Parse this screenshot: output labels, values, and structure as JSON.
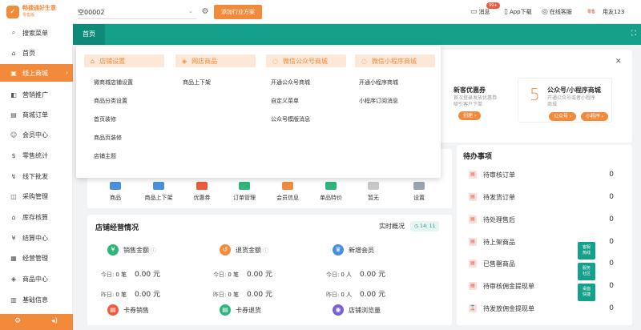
{
  "app": {
    "logo_line1": "畅捷通好生意",
    "logo_line2": "零售版",
    "store_select_value": "空00002",
    "add_plan_label": "添加行业方案",
    "msg_label": "消息",
    "msg_badge": "99+",
    "app_download_label": "App下载",
    "service_label": "在线客服",
    "avatar_text": "零售",
    "user_name": "用友123"
  },
  "sidebar": {
    "items": [
      {
        "label": "搜索菜单",
        "icon": "search-icon"
      },
      {
        "label": "首页",
        "icon": "home-icon"
      },
      {
        "label": "线上商城",
        "icon": "shop-icon"
      },
      {
        "label": "营销推广",
        "icon": "megaphone-icon"
      },
      {
        "label": "商城订单",
        "icon": "order-icon"
      },
      {
        "label": "会员中心",
        "icon": "member-icon"
      },
      {
        "label": "零售统计",
        "icon": "stats-icon"
      },
      {
        "label": "线下批发",
        "icon": "wholesale-icon"
      },
      {
        "label": "采购管理",
        "icon": "purchase-icon"
      },
      {
        "label": "库存核算",
        "icon": "inventory-icon"
      },
      {
        "label": "结算中心",
        "icon": "settlement-icon"
      },
      {
        "label": "经营管理",
        "icon": "management-icon"
      },
      {
        "label": "商品中心",
        "icon": "goods-icon"
      },
      {
        "label": "基础信息",
        "icon": "info-icon"
      }
    ],
    "active_index": 2
  },
  "tabs": {
    "home": "首页"
  },
  "dropdown": {
    "columns": [
      {
        "title": "店铺设置",
        "items": [
          "微商城店铺设置",
          "商品分类设置",
          "首页装修",
          "商品页装修",
          "店铺主题"
        ]
      },
      {
        "title": "网店商品",
        "items": [
          "商品上下架"
        ]
      },
      {
        "title": "微信公众号商城",
        "items": [
          "开通公众号商城",
          "自定义菜单",
          "公众号模版消息"
        ]
      },
      {
        "title": "微信小程序商城",
        "items": [
          "开通小程序商城",
          "小程序订阅消息"
        ]
      }
    ]
  },
  "promo": {
    "p1_title": "新客优惠券",
    "p1_desc1": "首次登录发放优惠券",
    "p1_desc2": "吸引客户下单",
    "p1_btn": "创建 ›",
    "p2_num": "5",
    "p2_title": "公众号/小程序商城",
    "p2_desc1": "开通公众号或者小程序",
    "p2_desc2": "商城",
    "p2_btn1": "公众号 ›",
    "p2_btn2": "小程序 ›"
  },
  "quick_icons": [
    {
      "label": "商品",
      "color": "#4a90e2"
    },
    {
      "label": "商品上下架",
      "color": "#4a90e2"
    },
    {
      "label": "优惠券",
      "color": "#f05a3c"
    },
    {
      "label": "订单管理",
      "color": "#2db67c"
    },
    {
      "label": "会员信息",
      "color": "#f28a3b"
    },
    {
      "label": "单品特价",
      "color": "#2db67c"
    },
    {
      "label": "暂无",
      "color": "#c8c8c8"
    },
    {
      "label": "设置",
      "color": "#9aa4b1"
    }
  ],
  "store_ops": {
    "title": "店铺经营情况",
    "realtime_label": "实时概况",
    "time": "14: 11",
    "stats": [
      {
        "label": "销售金额",
        "icon": "sales-icon",
        "color": "#2db67c",
        "today_label": "今日:",
        "today_count": "0 笔",
        "today_amount": "0.00 元",
        "yesterday_label": "昨日:",
        "yesterday_count": "0 笔",
        "yesterday_amount": "0.00 元"
      },
      {
        "label": "退货金额",
        "icon": "refund-icon",
        "color": "#f28a3b",
        "today_label": "今日:",
        "today_count": "0 笔",
        "today_amount": "0.00 元",
        "yesterday_label": "昨日:",
        "yesterday_count": "0 笔",
        "yesterday_amount": "0.00 元"
      },
      {
        "label": "新增会员",
        "icon": "crown-icon",
        "color": "#4a90e2",
        "today_label": "今日:",
        "today_count": "0 人",
        "today_amount": "0.00 元",
        "yesterday_label": "昨日:",
        "yesterday_count": "0 人",
        "yesterday_amount": "0.00 元"
      }
    ],
    "bottom": [
      {
        "label": "卡券销售",
        "color": "#f05a3c"
      },
      {
        "label": "卡券退货",
        "color": "#2db67c"
      },
      {
        "label": "店铺浏览量",
        "color": "#7b5fd6"
      }
    ]
  },
  "todo": {
    "title": "待办事项",
    "items": [
      {
        "label": "待审核订单",
        "count": "0"
      },
      {
        "label": "待发货订单",
        "count": "0"
      },
      {
        "label": "待处理售后",
        "count": "0"
      },
      {
        "label": "待上架商品",
        "count": "0"
      },
      {
        "label": "已售罄商品",
        "count": "0"
      },
      {
        "label": "待审核佣金提现单",
        "count": "0"
      },
      {
        "label": "待发放佣金提现单",
        "count": "0"
      }
    ],
    "tags": [
      "客服\n热线",
      "服务\n社区",
      "桌面\n快捷"
    ]
  },
  "colors": {
    "accent": "#f28a3b",
    "teal": "#15a08b"
  }
}
